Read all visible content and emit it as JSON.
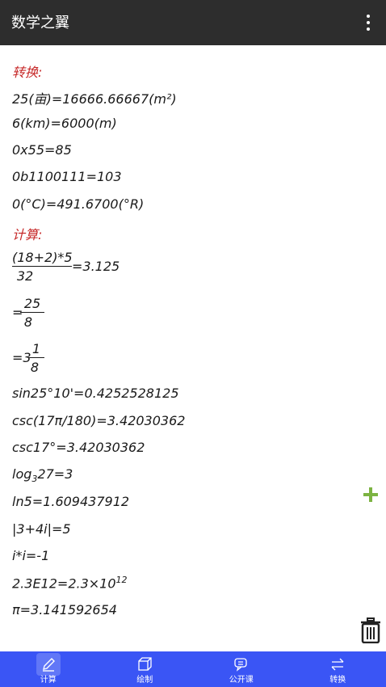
{
  "app": {
    "title": "数学之翼"
  },
  "content": {
    "convert_heading": "转换:",
    "convert_lines": [
      "25(亩)=16666.66667(m²)",
      "6(km)=6000(m)",
      "0x55=85",
      "0b1100111=103",
      "0(°C)=491.6700(°R)"
    ],
    "calc_heading": "计算:",
    "frac1": {
      "num": "(18+2)*5",
      "den": "32",
      "tail": "=3.125"
    },
    "frac2": {
      "lead": "=",
      "num": "25",
      "den": "8"
    },
    "frac3": {
      "lead": "=3",
      "num": "1",
      "den": "8"
    },
    "lines": {
      "sin": "sin25°10'=0.4252528125",
      "csc1": "csc(17π/180)=3.42030362",
      "csc2": "csc17°=3.42030362",
      "log_pre": "log",
      "log_sub": "3",
      "log_post": "27=3",
      "ln": "ln5=1.609437912",
      "abs": "|3+4i|=5",
      "imag": "i*i=-1",
      "sci_pre": "2.3E12=2.3×10",
      "sci_sup": "12",
      "pi": "π=3.141592654"
    }
  },
  "nav": {
    "tabs": [
      {
        "label": "计算",
        "icon": "pencil-icon"
      },
      {
        "label": "绘制",
        "icon": "cube-icon"
      },
      {
        "label": "公开课",
        "icon": "chat-icon"
      },
      {
        "label": "转换",
        "icon": "swap-icon"
      }
    ]
  },
  "colors": {
    "appbar": "#2d2d2d",
    "heading": "#c62828",
    "bottombar": "#3a55f5",
    "plus": "#7cb342"
  }
}
